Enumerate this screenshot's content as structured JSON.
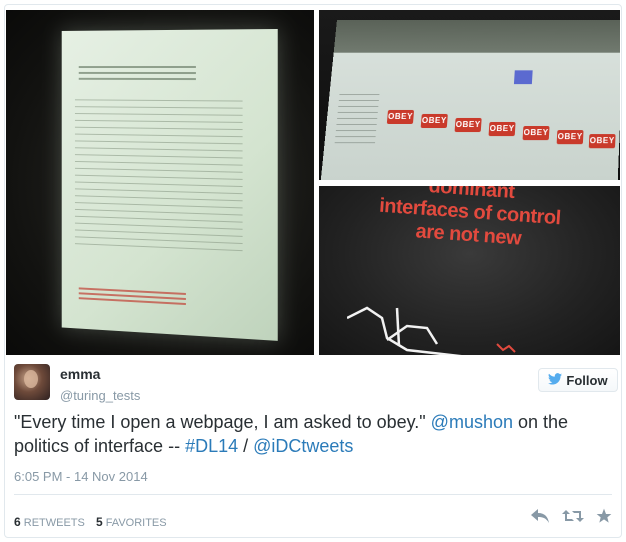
{
  "photos": {
    "slide3_lines": [
      "dominant",
      "interfaces of control",
      "are not new"
    ],
    "obey_label": "OBEY"
  },
  "tweet": {
    "name": "emma",
    "handle": "@turing_tests",
    "follow_label": "Follow",
    "text_before": "\"Every time I open a webpage, I am asked to obey.\" ",
    "mention_1": "@mushon",
    "text_mid": " on the politics of interface -- ",
    "hashtag": "#DL14",
    "separator": " / ",
    "mention_2": "@iDCtweets",
    "timestamp": "6:05 PM - 14 Nov 2014",
    "retweets_count": "6",
    "retweets_label": "RETWEETS",
    "favorites_count": "5",
    "favorites_label": "FAVORITES"
  },
  "icons": {
    "follow": "twitter-bird-icon",
    "reply": "reply-icon",
    "retweet": "retweet-icon",
    "favorite": "star-icon"
  },
  "colors": {
    "link": "#2b7bb9",
    "meta": "#8899a6",
    "text": "#292f33",
    "slide_red": "#e24a3e",
    "twitter_blue": "#55acee"
  }
}
